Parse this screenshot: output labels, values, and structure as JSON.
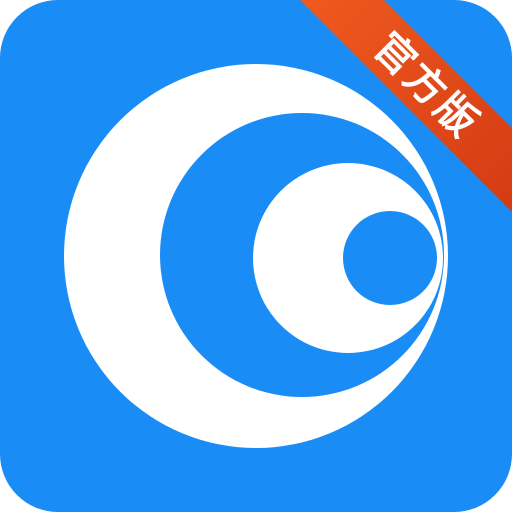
{
  "icon": {
    "name": "blue-concentric-crescent-app-icon",
    "colors": {
      "tile": "#1A8CF5",
      "mark_light": "#FFFFFF",
      "ribbon_top": "#EF5A1E",
      "ribbon_bottom": "#D43B14",
      "ribbon_text": "#FFFFFF"
    }
  },
  "badge": {
    "label": "官方版"
  }
}
